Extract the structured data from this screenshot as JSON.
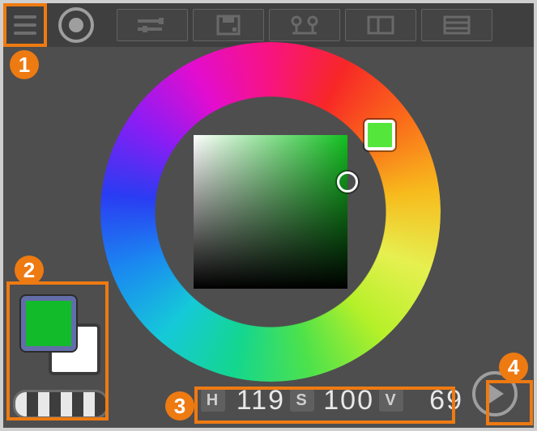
{
  "callouts": {
    "c1": "1",
    "c2": "2",
    "c3": "3",
    "c4": "4"
  },
  "tabs": {
    "sliders_icon": "sliders-icon",
    "save_icon": "save-icon",
    "eyedropper_icon": "eyedropper-icon",
    "split_icon": "split-view-icon",
    "history_icon": "history-icon"
  },
  "color": {
    "foreground_hex": "#12bb2a",
    "background_hex": "#ffffff",
    "hue_deg": 119,
    "sv_square_hue_hex": "#12c020"
  },
  "hsv": {
    "h_label": "H",
    "h_value": "119",
    "s_label": "S",
    "s_value": "100",
    "v_label": "V",
    "v_value": "69"
  }
}
